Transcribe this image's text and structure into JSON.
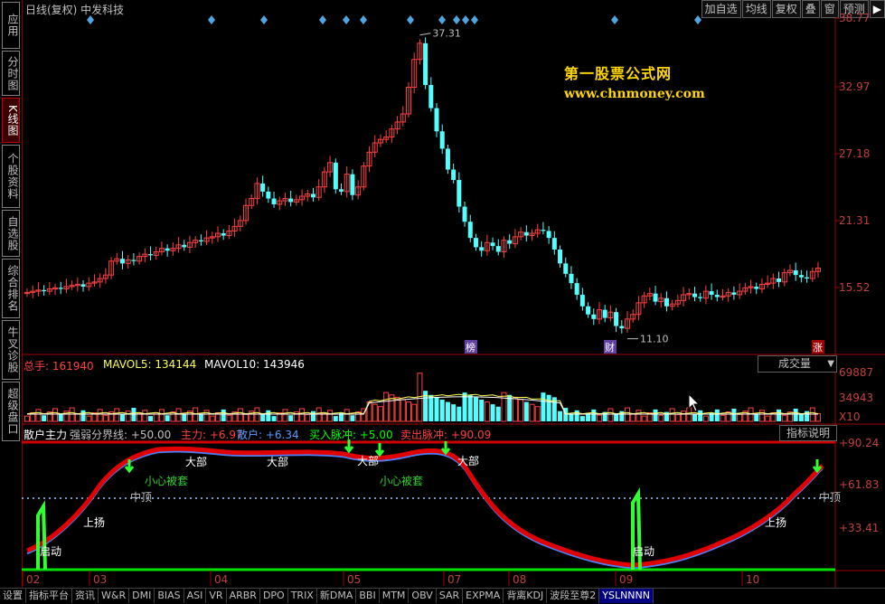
{
  "sidebar": {
    "tabs": [
      {
        "label": "应用",
        "active": false
      },
      {
        "label": "分时图",
        "active": false
      },
      {
        "label": "K线图",
        "active": true
      },
      {
        "label": "个股资料",
        "active": false
      },
      {
        "label": "自选股",
        "active": false
      },
      {
        "label": "综合排名",
        "active": false
      },
      {
        "label": "牛叉诊股",
        "active": false
      },
      {
        "label": "超级盘口",
        "active": false
      }
    ]
  },
  "header": {
    "title": "日线(复权) 中发科技",
    "buttons": [
      "加自选",
      "均线",
      "复权",
      "叠",
      "窗",
      "预测"
    ],
    "arrow_button": "▶"
  },
  "watermark": {
    "line1": "第一股票公式网",
    "line2": "www.chnmoney.com"
  },
  "price_panel": {
    "y_ticks": [
      "38.77",
      "32.97",
      "27.18",
      "21.31",
      "15.52"
    ],
    "high_label": "37.31",
    "low_label": "11.10",
    "markers": [
      "榜",
      "财",
      "涨"
    ],
    "up_color": "#ff4040",
    "down_color": "#54ffff"
  },
  "volume_panel": {
    "label_total": "总手: 161940",
    "label_ma5": "MAVOL5: 134144",
    "label_ma10": "MAVOL10: 143946",
    "y_ticks": [
      "69887",
      "34943",
      "X10"
    ],
    "selector": "成交量"
  },
  "indicator_panel": {
    "name": "散户主力",
    "line_label": "强弱分界线: +50.00",
    "main_label": "主力: +6.97",
    "retail_label": "散户: +6.34",
    "buy_label": "买入脉冲: +5.00",
    "sell_label": "卖出脉冲: +90.09",
    "y_ticks": [
      "+90.24",
      "+61.83",
      "+33.41"
    ],
    "explain_button": "指标说明",
    "annotations": [
      "小心被套",
      "小心被套",
      "中顶",
      "中顶",
      "大部",
      "大部",
      "大部",
      "大部",
      "上扬",
      "上扬",
      "启动",
      "启动"
    ]
  },
  "date_axis": [
    "02",
    "03",
    "04",
    "05",
    "07",
    "08",
    "09",
    "10"
  ],
  "bottom_tabs": [
    "设置",
    "指标平台",
    "资讯",
    "W&R",
    "DMI",
    "BIAS",
    "ASI",
    "VR",
    "ARBR",
    "DPO",
    "TRIX",
    "新DMA",
    "BBI",
    "MTM",
    "OBV",
    "SAR",
    "EXPMA",
    "背离KDJ",
    "波段至尊2",
    "YSLNNNN"
  ],
  "bottom_active": "YSLNNNN"
}
